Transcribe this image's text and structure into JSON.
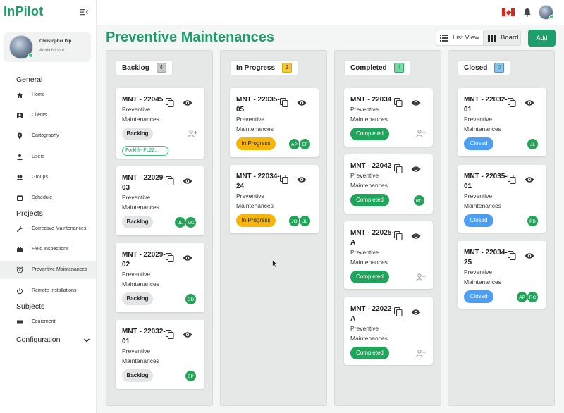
{
  "app": {
    "logo": "InPilot"
  },
  "profile": {
    "name": "Christopher Dip",
    "role": "Administrator"
  },
  "sidebar": {
    "sections": {
      "general": "General",
      "projects": "Projects",
      "subjects": "Subjects",
      "configuration": "Configuration"
    },
    "items": [
      {
        "label": "Home",
        "icon": "home-icon"
      },
      {
        "label": "Clients",
        "icon": "contact-icon"
      },
      {
        "label": "Cartography",
        "icon": "map-pin-icon"
      },
      {
        "label": "Users",
        "icon": "person-icon"
      },
      {
        "label": "Groups",
        "icon": "group-icon"
      },
      {
        "label": "Schedule",
        "icon": "calendar-icon"
      },
      {
        "label": "Corrective Maintenances",
        "icon": "wrench-icon"
      },
      {
        "label": "Field Inspections",
        "icon": "briefcase-icon"
      },
      {
        "label": "Preventive Maintenances",
        "icon": "alarm-icon"
      },
      {
        "label": "Remote Installations",
        "icon": "power-icon"
      },
      {
        "label": "Equipment",
        "icon": "equipment-icon"
      }
    ]
  },
  "header": {
    "title": "Preventive Maintenances",
    "list_view": "List View",
    "board": "Board",
    "add": "Add"
  },
  "colors": {
    "brand": "#1e9e6a",
    "in_progress": "#f5b50d",
    "completed": "#20a35a",
    "closed": "#4d9df0"
  },
  "columns": [
    {
      "title": "Backlog",
      "count": "4",
      "cards": [
        {
          "title": "MNT - 22045",
          "subtitle": "Preventive Maintenances",
          "status": "Backlog",
          "tag": "Forklift- FL22..."
        },
        {
          "title": "MNT - 22029-03",
          "subtitle": "Preventive Maintenances",
          "status": "Backlog",
          "badges": [
            "JL",
            "MC"
          ]
        },
        {
          "title": "MNT - 22029-02",
          "subtitle": "Preventive Maintenances",
          "status": "Backlog",
          "badges": [
            "DD"
          ]
        },
        {
          "title": "MNT - 22032-01",
          "subtitle": "Preventive Maintenances",
          "status": "Backlog",
          "badges": [
            "BP"
          ]
        }
      ]
    },
    {
      "title": "In Progress",
      "count": "2",
      "cards": [
        {
          "title": "MNT - 22035-05",
          "subtitle": "Preventive Maintenances",
          "status": "In Progress",
          "badges": [
            "AP",
            "EF"
          ]
        },
        {
          "title": "MNT - 22034-24",
          "subtitle": "Preventive Maintenances",
          "status": "In Progress",
          "badges": [
            "JO",
            "JL"
          ]
        }
      ]
    },
    {
      "title": "Completed",
      "count": "4",
      "cards": [
        {
          "title": "MNT - 22034",
          "subtitle": "Preventive Maintenances",
          "status": "Completed"
        },
        {
          "title": "MNT - 22042",
          "subtitle": "Preventive Maintenances",
          "status": "Completed",
          "badges": [
            "RC"
          ]
        },
        {
          "title": "MNT - 22025-A",
          "subtitle": "Preventive Maintenances",
          "status": "Completed"
        },
        {
          "title": "MNT - 22022-A",
          "subtitle": "Preventive Maintenances",
          "status": "Completed"
        }
      ]
    },
    {
      "title": "Closed",
      "count": "3",
      "cards": [
        {
          "title": "MNT - 22032-01",
          "subtitle": "Preventive Maintenances",
          "status": "Closed",
          "badges": [
            "JL"
          ]
        },
        {
          "title": "MNT - 22035-01",
          "subtitle": "Preventive Maintenances",
          "status": "Closed",
          "badges": [
            "PB"
          ]
        },
        {
          "title": "MNT - 22034-25",
          "subtitle": "Preventive Maintenances",
          "status": "Closed",
          "badges": [
            "AP",
            "RC"
          ]
        }
      ]
    }
  ]
}
